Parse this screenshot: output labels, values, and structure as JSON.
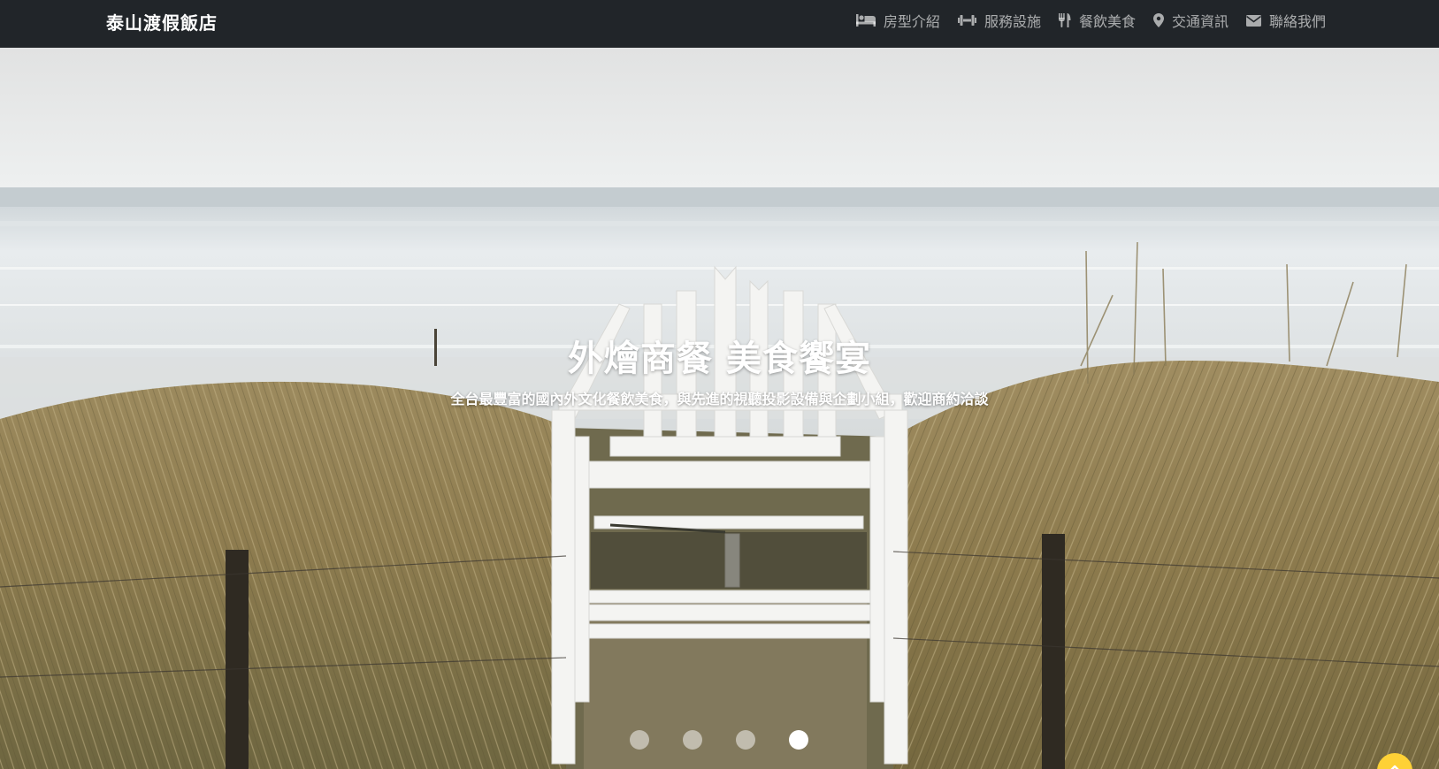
{
  "navbar": {
    "brand": "泰山渡假飯店",
    "items": [
      {
        "label": "房型介紹",
        "icon": "bed-icon"
      },
      {
        "label": "服務設施",
        "icon": "dumbbell-icon"
      },
      {
        "label": "餐飲美食",
        "icon": "utensils-icon"
      },
      {
        "label": "交通資訊",
        "icon": "map-marker-icon"
      },
      {
        "label": "聯絡我們",
        "icon": "envelope-icon"
      }
    ]
  },
  "carousel": {
    "caption_title": "外燴商餐 美食饗宴",
    "caption_subtitle": "全台最豐富的國內外文化餐飲美食，與先進的視聽投影設備與企劃小組，歡迎商約洽談",
    "slide_count": 4,
    "active_index": 3
  },
  "back_to_top": {
    "icon": "double-chevron-up-icon"
  },
  "colors": {
    "navbar_bg": "#212529",
    "accent": "#fed136"
  }
}
